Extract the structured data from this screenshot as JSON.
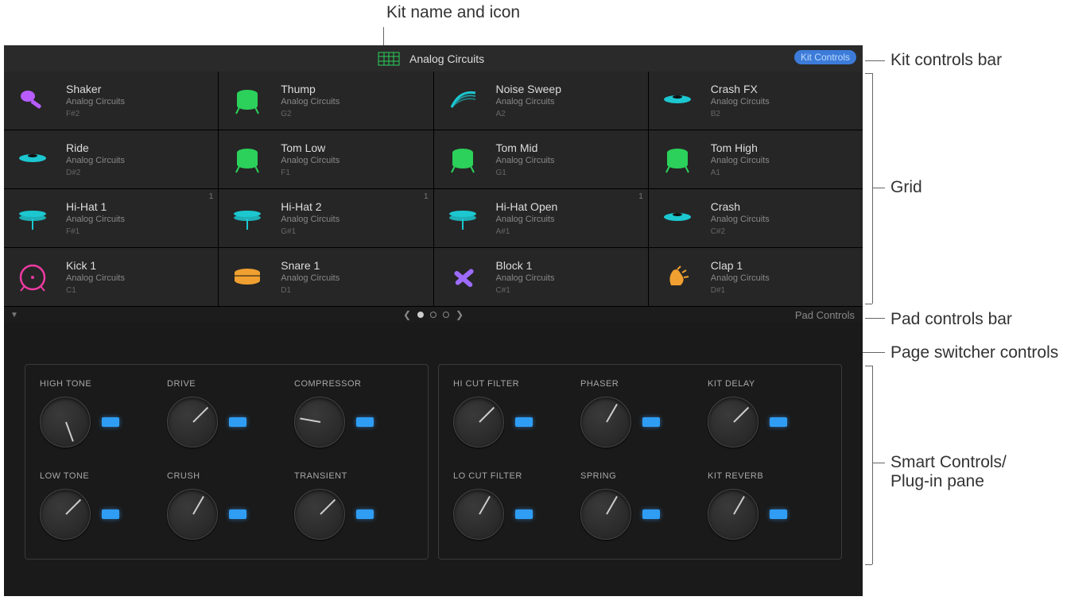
{
  "annotations": {
    "top": "Kit name and icon",
    "kit_bar": "Kit controls bar",
    "grid": "Grid",
    "pad_bar": "Pad controls bar",
    "page_switch": "Page switcher controls",
    "smart": "Smart Controls/\nPlug-in pane"
  },
  "kit": {
    "name": "Analog Circuits",
    "button": "Kit Controls"
  },
  "kit_sub": "Analog Circuits",
  "pads": [
    {
      "name": "Shaker",
      "note": "F#2",
      "icon": "shaker",
      "color": "#b85cff"
    },
    {
      "name": "Thump",
      "note": "G2",
      "icon": "tom",
      "color": "#2bd15a"
    },
    {
      "name": "Noise Sweep",
      "note": "A2",
      "icon": "sweep",
      "color": "#1cc7d0"
    },
    {
      "name": "Crash FX",
      "note": "B2",
      "icon": "cymbal",
      "color": "#1cc7d0"
    },
    {
      "name": "Ride",
      "note": "D#2",
      "icon": "cymbal",
      "color": "#1cc7d0"
    },
    {
      "name": "Tom Low",
      "note": "F1",
      "icon": "tom",
      "color": "#2bd15a"
    },
    {
      "name": "Tom Mid",
      "note": "G1",
      "icon": "tom",
      "color": "#2bd15a"
    },
    {
      "name": "Tom High",
      "note": "A1",
      "icon": "tom",
      "color": "#2bd15a"
    },
    {
      "name": "Hi-Hat 1",
      "note": "F#1",
      "icon": "hihat",
      "color": "#1cc7d0",
      "corner": "1"
    },
    {
      "name": "Hi-Hat 2",
      "note": "G#1",
      "icon": "hihat",
      "color": "#1cc7d0",
      "corner": "1"
    },
    {
      "name": "Hi-Hat Open",
      "note": "A#1",
      "icon": "hihat",
      "color": "#1cc7d0",
      "corner": "1"
    },
    {
      "name": "Crash",
      "note": "C#2",
      "icon": "cymbal",
      "color": "#1cc7d0"
    },
    {
      "name": "Kick 1",
      "note": "C1",
      "icon": "kick",
      "color": "#ef3ba3"
    },
    {
      "name": "Snare 1",
      "note": "D1",
      "icon": "snare",
      "color": "#f0a030"
    },
    {
      "name": "Block 1",
      "note": "C#1",
      "icon": "sticks",
      "color": "#9d6bff"
    },
    {
      "name": "Clap 1",
      "note": "D#1",
      "icon": "clap",
      "color": "#f0a030"
    }
  ],
  "pad_bar_label": "Pad Controls",
  "knobs_left": [
    {
      "label": "HIGH TONE",
      "angle": -20
    },
    {
      "label": "DRIVE",
      "angle": -135
    },
    {
      "label": "COMPRESSOR",
      "angle": 100
    },
    {
      "label": "LOW TONE",
      "angle": -135
    },
    {
      "label": "CRUSH",
      "angle": -150
    },
    {
      "label": "TRANSIENT",
      "angle": -135
    }
  ],
  "knobs_right": [
    {
      "label": "HI CUT FILTER",
      "angle": -135
    },
    {
      "label": "PHASER",
      "angle": -150
    },
    {
      "label": "KIT DELAY",
      "angle": -135
    },
    {
      "label": "LO CUT FILTER",
      "angle": -150
    },
    {
      "label": "SPRING",
      "angle": -150
    },
    {
      "label": "KIT REVERB",
      "angle": -150
    }
  ]
}
